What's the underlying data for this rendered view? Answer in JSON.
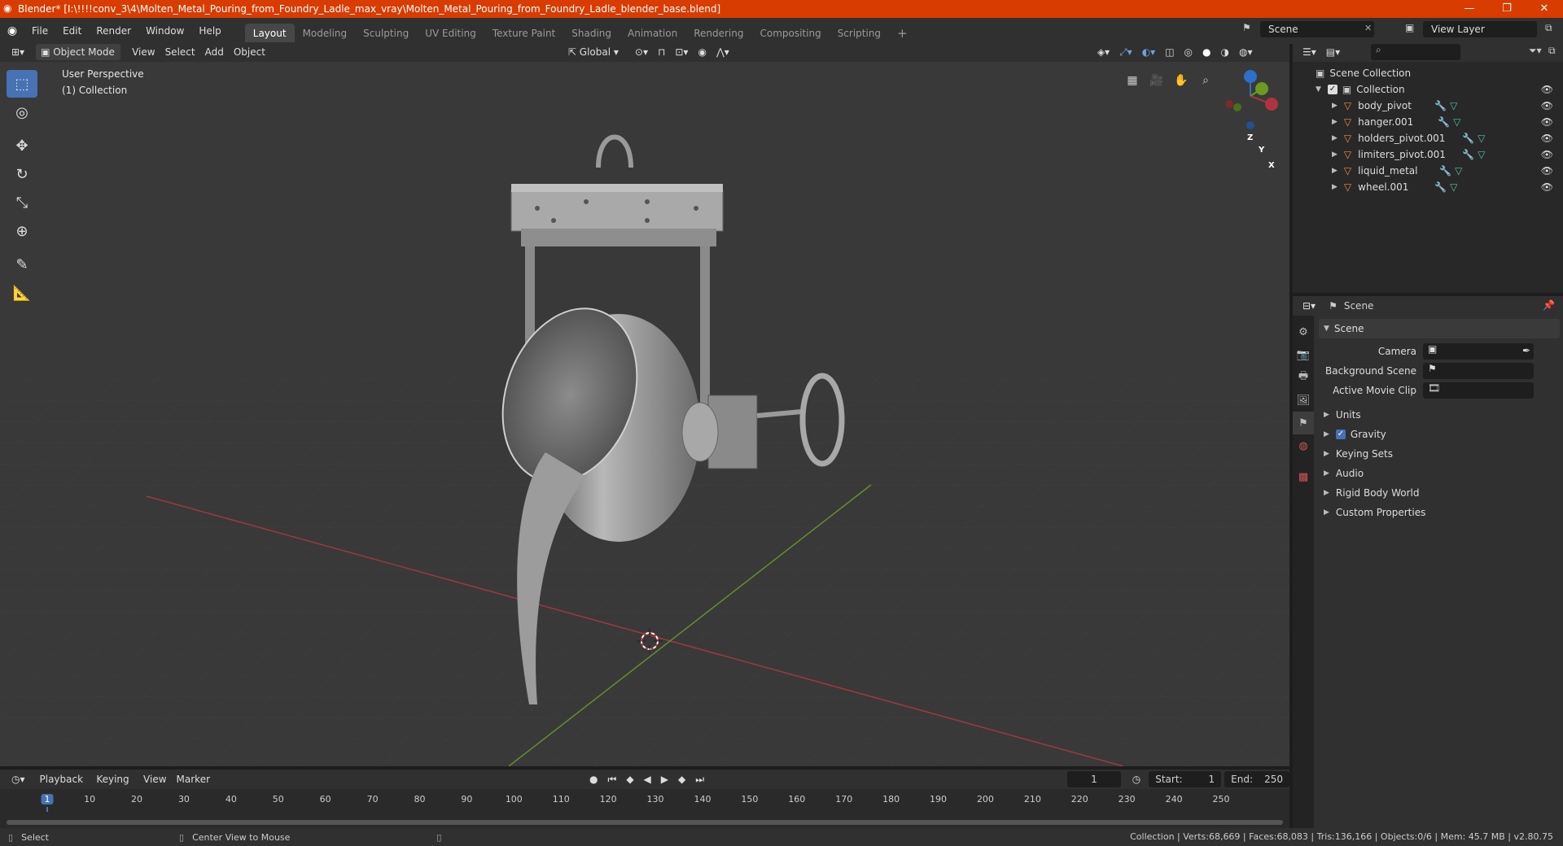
{
  "titlebar": {
    "title": "Blender* [I:\\!!!!conv_3\\4\\Molten_Metal_Pouring_from_Foundry_Ladle_max_vray\\Molten_Metal_Pouring_from_Foundry_Ladle_blender_base.blend]",
    "min": "—",
    "max": "❐",
    "close": "✕"
  },
  "menu": {
    "items": [
      "File",
      "Edit",
      "Render",
      "Window",
      "Help"
    ]
  },
  "workspaces": [
    "Layout",
    "Modeling",
    "Sculpting",
    "UV Editing",
    "Texture Paint",
    "Shading",
    "Animation",
    "Rendering",
    "Compositing",
    "Scripting"
  ],
  "workspace_add": "+",
  "scene": {
    "name": "Scene",
    "view_layer": "View Layer"
  },
  "viewport_header": {
    "mode": "Object Mode",
    "menus": [
      "View",
      "Select",
      "Add",
      "Object"
    ],
    "transform": "Global"
  },
  "viewport": {
    "perspective": "User Perspective",
    "collection": "(1) Collection",
    "gizmo": {
      "x": "X",
      "y": "Y",
      "z": "Z"
    }
  },
  "outliner": {
    "root": "Scene Collection",
    "collection": "Collection",
    "objects": [
      "body_pivot",
      "hanger.001",
      "holders_pivot.001",
      "limiters_pivot.001",
      "liquid_metal",
      "wheel.001"
    ]
  },
  "properties": {
    "header": "Scene",
    "panel": "Scene",
    "fields": [
      {
        "label": "Camera",
        "value": ""
      },
      {
        "label": "Background Scene",
        "value": ""
      },
      {
        "label": "Active Movie Clip",
        "value": ""
      }
    ],
    "sections": [
      "Units",
      "Gravity",
      "Keying Sets",
      "Audio",
      "Rigid Body World",
      "Custom Properties"
    ],
    "gravity_checked": true
  },
  "timeline": {
    "menus": [
      "Playback",
      "Keying",
      "View",
      "Marker"
    ],
    "current_frame": "1",
    "start_label": "Start:",
    "start": "1",
    "end_label": "End:",
    "end": "250",
    "ticks": [
      "1",
      "10",
      "20",
      "30",
      "40",
      "50",
      "60",
      "70",
      "80",
      "90",
      "100",
      "110",
      "120",
      "130",
      "140",
      "150",
      "160",
      "170",
      "180",
      "190",
      "200",
      "210",
      "220",
      "230",
      "240",
      "250"
    ]
  },
  "statusbar": {
    "select": "Select",
    "center": "Center View to Mouse",
    "stats": "Collection | Verts:68,669 | Faces:68,083 | Tris:136,166 | Objects:0/6 | Mem: 45.7 MB | v2.80.75"
  },
  "colors": {
    "accent": "#4772b3",
    "titlebar": "#d83c00",
    "x_axis": "#b0343c",
    "y_axis": "#6a9a22",
    "z_axis": "#2e6fc9"
  }
}
